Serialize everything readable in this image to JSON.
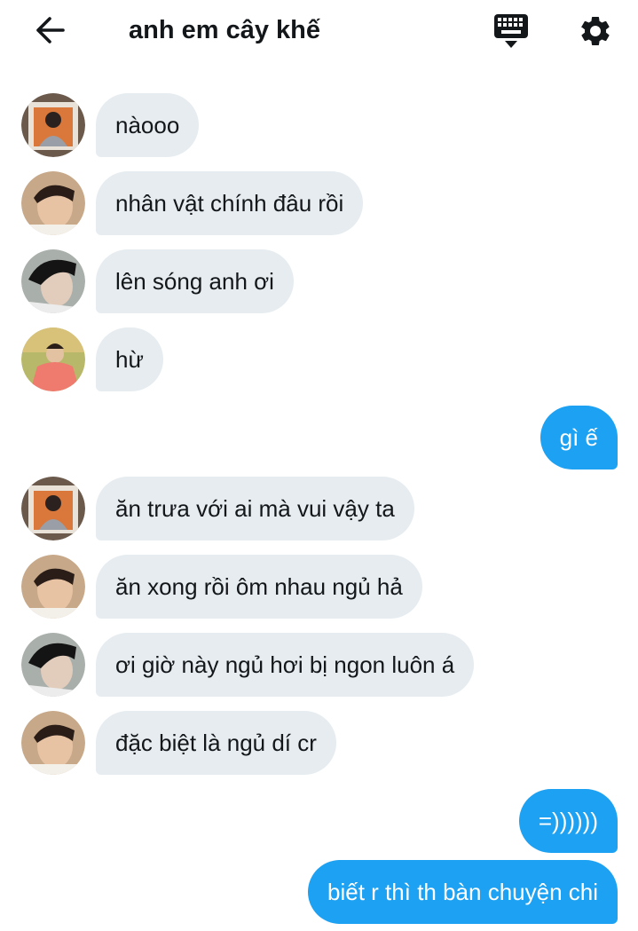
{
  "header": {
    "title": "anh em cây khế",
    "back_icon": "arrow-left-icon",
    "keyboard_icon": "keyboard-icon",
    "settings_icon": "gear-icon"
  },
  "colors": {
    "incoming_bubble": "#e6ecf0",
    "outgoing_bubble": "#1da1f2",
    "text": "#14171a"
  },
  "messages": [
    {
      "direction": "in",
      "avatar": "avatar-member-1",
      "text": "nàooo"
    },
    {
      "direction": "in",
      "avatar": "avatar-member-2",
      "text": "nhân vật chính đâu rồi"
    },
    {
      "direction": "in",
      "avatar": "avatar-member-3",
      "text": "lên sóng anh ơi"
    },
    {
      "direction": "in",
      "avatar": "avatar-member-4",
      "text": "hừ"
    },
    {
      "direction": "out",
      "text": "gì ế"
    },
    {
      "direction": "in",
      "avatar": "avatar-member-1",
      "text": "ăn trưa với ai mà vui vậy ta"
    },
    {
      "direction": "in",
      "avatar": "avatar-member-2",
      "text": "ăn xong rồi ôm nhau ngủ hả"
    },
    {
      "direction": "in",
      "avatar": "avatar-member-3",
      "text": "ơi giờ này ngủ hơi bị ngon luôn á"
    },
    {
      "direction": "in",
      "avatar": "avatar-member-2",
      "text": "đặc biệt là ngủ dí cr"
    },
    {
      "direction": "out",
      "text": "=))))))"
    },
    {
      "direction": "out",
      "text": "biết r thì th bàn chuyện chi"
    }
  ]
}
